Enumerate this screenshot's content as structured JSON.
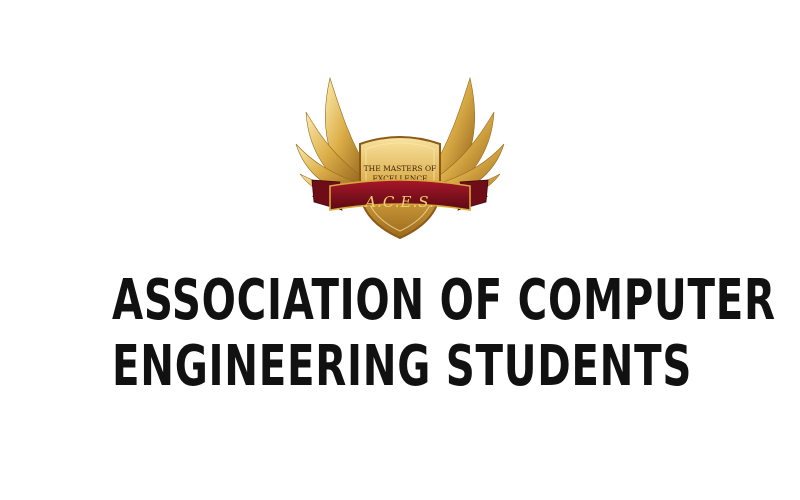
{
  "logo": {
    "motto": "THE MASTERS OF EXCELLENCE",
    "motto_line1": "THE MASTERS OF",
    "motto_line2": "EXCELLENCE",
    "acronym": "A.C.E.S.",
    "colors": {
      "gold_light": "#f3d98a",
      "gold": "#d7a73c",
      "gold_dark": "#8a5a16",
      "ribbon": "#8f1220",
      "ribbon_dark": "#5a0a12"
    }
  },
  "organization": {
    "line1": "ASSOCIATION OF COMPUTER",
    "line2": "ENGINEERING STUDENTS",
    "color": "#111111"
  }
}
